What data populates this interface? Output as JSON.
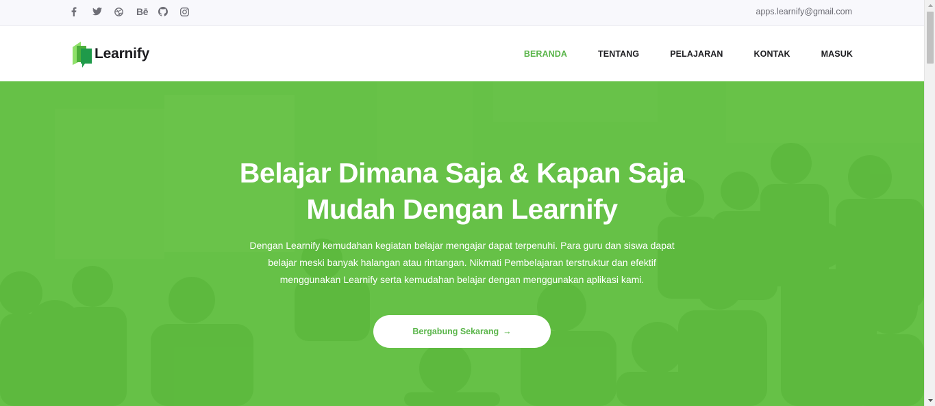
{
  "topbar": {
    "social": [
      {
        "icon": "facebook-icon"
      },
      {
        "icon": "twitter-icon"
      },
      {
        "icon": "dribbble-icon"
      },
      {
        "icon": "behance-icon",
        "text": "Bē"
      },
      {
        "icon": "github-icon"
      },
      {
        "icon": "instagram-icon"
      }
    ],
    "email": "apps.learnify@gmail.com"
  },
  "nav": {
    "brand": "Learnify",
    "items": [
      {
        "label": "BERANDA",
        "active": true
      },
      {
        "label": "TENTANG",
        "active": false
      },
      {
        "label": "PELAJARAN",
        "active": false
      },
      {
        "label": "KONTAK",
        "active": false
      },
      {
        "label": "MASUK",
        "active": false
      }
    ]
  },
  "hero": {
    "title_line1": "Belajar Dimana Saja & Kapan Saja",
    "title_line2": "Mudah Dengan Learnify",
    "description": "Dengan Learnify kemudahan kegiatan belajar mengajar dapat terpenuhi. Para guru dan siswa dapat belajar meski banyak halangan atau rintangan. Nikmati Pembelajaran terstruktur dan efektif menggunakan Learnify serta kemudahan belajar dengan menggunakan aplikasi kami.",
    "cta_label": "Bergabung Sekarang",
    "cta_arrow": "→"
  },
  "colors": {
    "accent": "#5ab54a",
    "hero_overlay": "#5ebe3c",
    "text_dark": "#1e1e22"
  }
}
